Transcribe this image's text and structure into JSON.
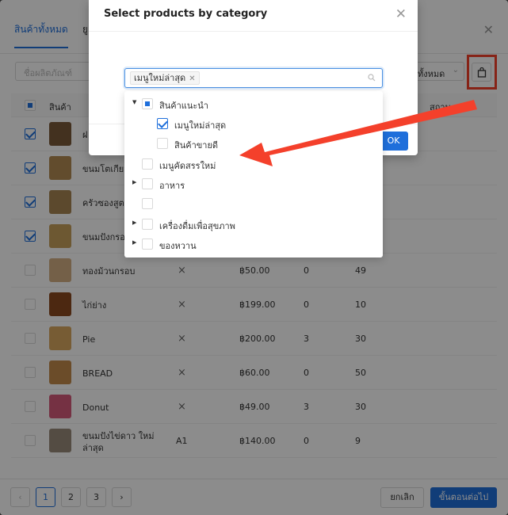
{
  "back": {
    "tabs": [
      "สินค้าทั้งหมด",
      "ยู"
    ],
    "search_placeholder": "ชื่อผลิตภัณฑ์",
    "filter_value": "ทั้งหมด",
    "headers": {
      "product": "สินค้า",
      "status": "สถานะ"
    },
    "rows": [
      {
        "name": "ฝ",
        "checked": true,
        "thumb": "#7a5a3a"
      },
      {
        "name": "ขนมโตเกียว",
        "checked": true,
        "thumb": "#b28a52"
      },
      {
        "name": "ครัวซองสูตร งเศษ",
        "checked": true,
        "thumb": "#a88653"
      },
      {
        "name": "ขนมปังกรอบ",
        "checked": true,
        "thumb": "#c7a05c"
      },
      {
        "name": "ทองม้วนกรอบ",
        "checked": false,
        "thumb": "#d4b084",
        "x": "×",
        "price": "฿50.00",
        "c1": "0",
        "c2": "49"
      },
      {
        "name": "ไก่ย่าง",
        "checked": false,
        "thumb": "#8b4a20",
        "x": "×",
        "price": "฿199.00",
        "c1": "0",
        "c2": "10"
      },
      {
        "name": "Pie",
        "checked": false,
        "thumb": "#d9a860",
        "x": "×",
        "price": "฿200.00",
        "c1": "3",
        "c2": "30"
      },
      {
        "name": "BREAD",
        "checked": false,
        "thumb": "#c48a4c",
        "x": "×",
        "price": "฿60.00",
        "c1": "0",
        "c2": "50"
      },
      {
        "name": "Donut",
        "checked": false,
        "thumb": "#d65a7a",
        "x": "×",
        "price": "฿49.00",
        "c1": "3",
        "c2": "30"
      },
      {
        "name": "ขนมปังไข่ดาว ใหม่ล่าสุด",
        "checked": false,
        "thumb": "#9a8a7a",
        "sku": "A1",
        "price": "฿140.00",
        "c1": "0",
        "c2": "9"
      }
    ],
    "pages": [
      "1",
      "2",
      "3"
    ],
    "cancel": "ยกเลิก",
    "next": "ขั้นตอนต่อไป"
  },
  "modal": {
    "title": "Select products by category",
    "selected_tag": "เมนูใหม่ล่าสุด",
    "ok": "OK",
    "tree": [
      {
        "label": "สินค้าแนะนำ",
        "state": "indeterminate",
        "caret": "down",
        "level": 0
      },
      {
        "label": "เมนูใหม่ล่าสุด",
        "state": "checked",
        "caret": "",
        "level": 1
      },
      {
        "label": "สินค้าขายดี",
        "state": "unchecked",
        "caret": "",
        "level": 1
      },
      {
        "label": "เมนูคัดสรรใหม่",
        "state": "unchecked",
        "caret": "",
        "level": 0
      },
      {
        "label": "อาหาร",
        "state": "unchecked",
        "caret": "right",
        "level": 0
      },
      {
        "label": "",
        "state": "unchecked",
        "caret": "",
        "level": 0
      },
      {
        "label": "เครื่องดื่มเพื่อสุขภาพ",
        "state": "unchecked",
        "caret": "right",
        "level": 0
      },
      {
        "label": "ของหวาน",
        "state": "unchecked",
        "caret": "right",
        "level": 0
      }
    ]
  },
  "colors": {
    "accent": "#1f6fdb",
    "annotation": "#f4402b"
  },
  "icons": {
    "bag": "shopping-bag-icon",
    "search": "search-icon",
    "close": "close-icon"
  }
}
